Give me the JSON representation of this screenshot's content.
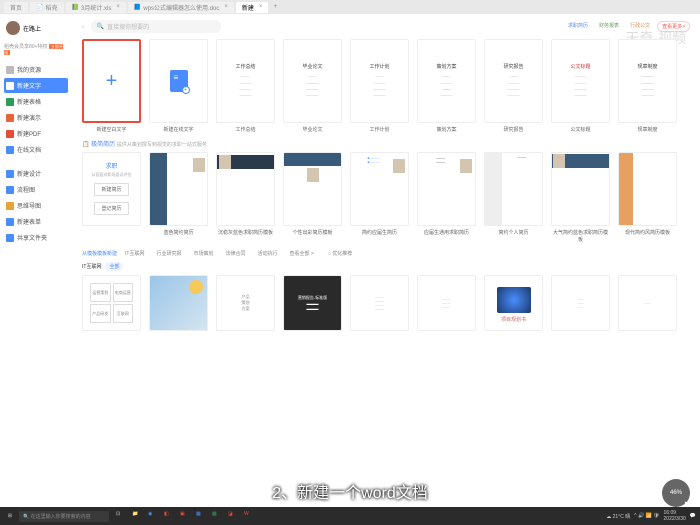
{
  "tabs": {
    "t1": "首页",
    "t2": "稻壳",
    "t3": "3月统计.xls",
    "t4": "wps公式编辑器怎么使用.doc",
    "t5": "新建"
  },
  "user": {
    "name": "在路上",
    "vip": "稻壳会员享80+特权",
    "badge": "立即开通"
  },
  "nav": {
    "n1": "我的资源",
    "n2": "新建文字",
    "n3": "新建表格",
    "n4": "新建演示",
    "n5": "新建PDF",
    "n6": "在线文档",
    "n7": "新建设计",
    "n8": "流程图",
    "n9": "思维导图",
    "n10": "新建表单",
    "n11": "共享文件夹"
  },
  "search": {
    "placeholder": "直接搜你想要的"
  },
  "chips": {
    "c1": "求职简历",
    "c2": "财务报表",
    "c3": "行政公文",
    "c4": "查看更多>"
  },
  "watermark": "天奇·视频",
  "templates": {
    "t1": "新建空白文字",
    "t2": "新建在线文字",
    "t3": "工作总结",
    "t4": "毕业论文",
    "t5": "工作计划",
    "t6": "策划方案",
    "t7": "研究报告",
    "t8": "公文标题",
    "t9": "规章制度",
    "h3": "工作总结",
    "h4": "毕业论文",
    "h5": "工作计划",
    "h6": "策划方案",
    "h7": "研究报告",
    "h8": "公文标题",
    "h9": "规章制度"
  },
  "resume": {
    "title": "极简简历",
    "sub": "提供从策划撰写到视觉的求职一站式服务",
    "card1": "求职",
    "card1sub": "从容面对职场面试评估",
    "btn1": "新建简历",
    "btn2": "登记简历",
    "l1": "蓝色简约简历",
    "l2": "沉稳灰蓝色求职简历模板",
    "l3": "个性出彩简历模板",
    "l4": "简约应届生简历",
    "l5": "应届生通用求职简历",
    "l6": "简约个人简历",
    "l7": "大气简约蓝色求职简历模板",
    "l8": "现代简约风简历模板"
  },
  "filters": {
    "lbl": "从模板模板新建",
    "f1": "IT互联网",
    "f2": "行业研究报",
    "f3": "市场策划",
    "f4": "法律合同",
    "f5": "活动执行",
    "more": "查看全部 >",
    "opt": "优化推荐"
  },
  "it": {
    "lbl": "IT互联网",
    "all": "全部",
    "c1": "运营策划",
    "c2": "电商运营",
    "c3": "产品研发",
    "c4": "互联网"
  },
  "caption": "2、新建一个word文档",
  "progress": "46%",
  "taskbar": {
    "search": "在这里输入你要搜索的内容",
    "weather": "21°C 晴",
    "time": "16:09",
    "date": "2022/3/30"
  }
}
